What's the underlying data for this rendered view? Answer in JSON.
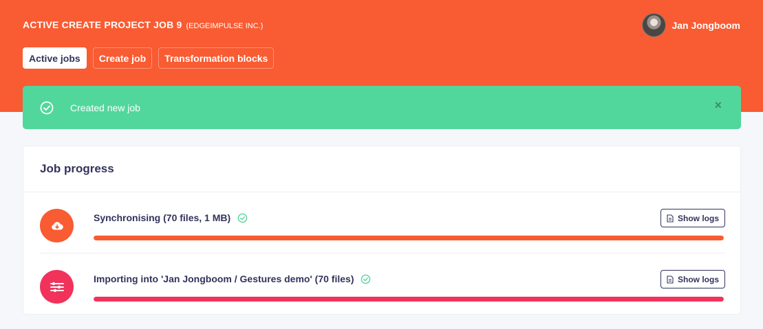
{
  "header": {
    "title": "ACTIVE CREATE PROJECT JOB 9",
    "org": "(EDGEIMPULSE INC.)",
    "user_name": "Jan Jongboom",
    "brand_color": "#f95b32"
  },
  "tabs": [
    {
      "label": "Active jobs",
      "active": true
    },
    {
      "label": "Create job",
      "active": false
    },
    {
      "label": "Transformation blocks",
      "active": false
    }
  ],
  "alert": {
    "icon": "check-circle-icon",
    "message": "Created new job",
    "close_label": "×",
    "color": "#51d79c"
  },
  "card": {
    "title": "Job progress",
    "steps": [
      {
        "icon": "cloud-download-icon",
        "label": "Synchronising (70 files, 1 MB)",
        "status_icon": "check-circle-icon",
        "button_label": "Show logs",
        "progress": 1.0,
        "color": "#f95b32"
      },
      {
        "icon": "sliders-icon",
        "label": "Importing into 'Jan Jongboom / Gestures demo' (70 files)",
        "status_icon": "check-circle-icon",
        "button_label": "Show logs",
        "progress": 1.0,
        "color": "#f1325b"
      }
    ]
  }
}
